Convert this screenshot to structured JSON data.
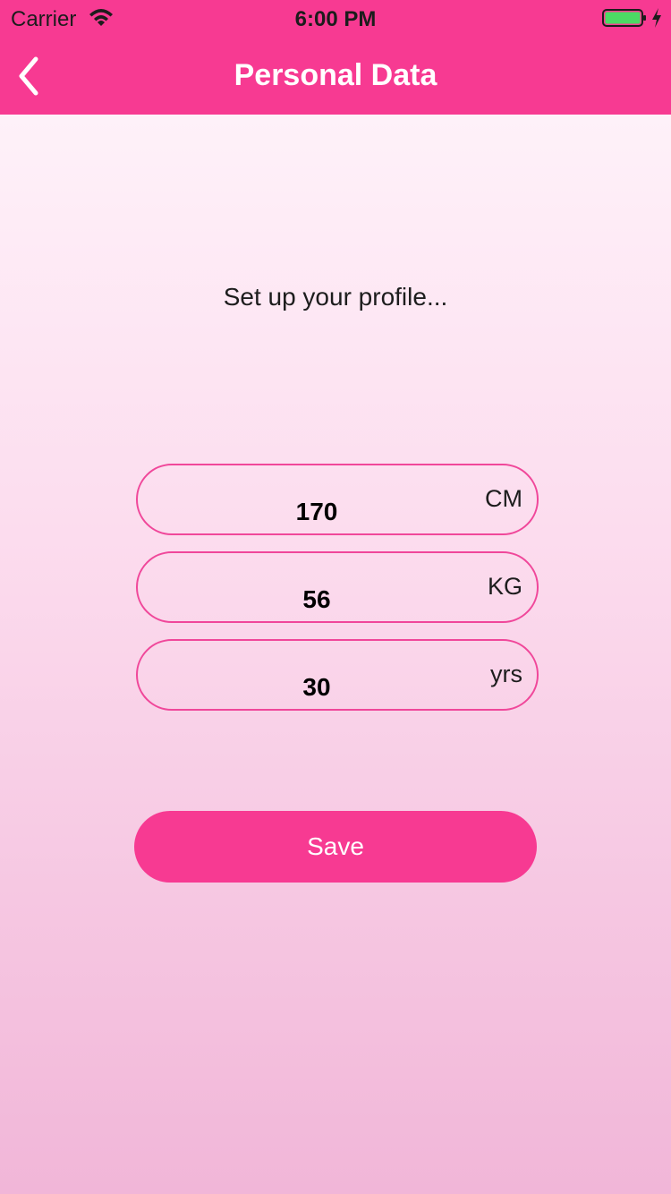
{
  "status_bar": {
    "carrier": "Carrier",
    "time": "6:00 PM",
    "battery_color": "#4cd964"
  },
  "nav": {
    "title": "Personal Data",
    "back_icon": "chevron-left-icon",
    "background": "#f73a92"
  },
  "main": {
    "subtitle": "Set up your profile...",
    "fields": [
      {
        "value": "170",
        "unit": "CM"
      },
      {
        "value": "56",
        "unit": "KG"
      },
      {
        "value": "30",
        "unit": "yrs"
      }
    ],
    "save_label": "Save"
  }
}
